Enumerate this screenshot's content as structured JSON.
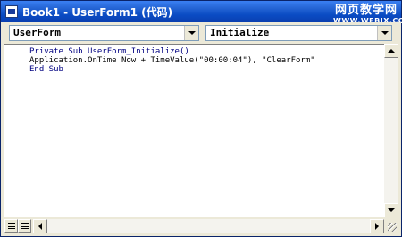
{
  "window": {
    "title": "Book1 - UserForm1 (代码)"
  },
  "watermark": {
    "line1": "网页教学网",
    "line2": "WWW.WEBJX.COM"
  },
  "object_combo": {
    "value": "UserForm"
  },
  "procedure_combo": {
    "value": "Initialize"
  },
  "code": {
    "line1": "Private Sub UserForm_Initialize()",
    "line2": "Application.OnTime Now + TimeValue(\"00:00:04\"), \"ClearForm\"",
    "line3": "End Sub"
  },
  "colors": {
    "titlebar": "#0a4cc4",
    "chrome": "#ece9d8",
    "code_background": "#ffffff",
    "keyword": "#000080"
  },
  "icons": {
    "window": "vba-window-icon",
    "dropdown": "chevron-down-icon",
    "procedure_view": "procedure-view-icon",
    "full_module_view": "full-module-view-icon"
  }
}
